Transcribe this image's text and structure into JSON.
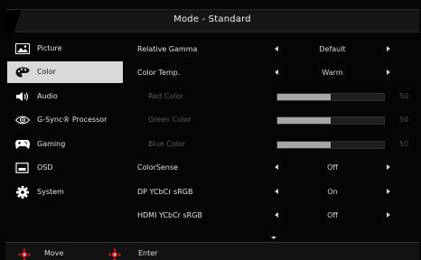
{
  "header": {
    "title": "Mode - Standard"
  },
  "sidebar": {
    "items": [
      {
        "label": "Picture",
        "icon": "picture-icon"
      },
      {
        "label": "Color",
        "icon": "palette-icon",
        "selected": true
      },
      {
        "label": "Audio",
        "icon": "speaker-icon"
      },
      {
        "label": "G-Sync® Processor",
        "icon": "gsync-eye-icon"
      },
      {
        "label": "Gaming",
        "icon": "gamepad-icon"
      },
      {
        "label": "OSD",
        "icon": "osd-screen-icon"
      },
      {
        "label": "System",
        "icon": "gear-icon"
      }
    ]
  },
  "settings": {
    "rows": [
      {
        "label": "Relative Gamma",
        "type": "select",
        "value": "Default"
      },
      {
        "label": "Color Temp.",
        "type": "select",
        "value": "Warm"
      },
      {
        "label": "Red Color",
        "type": "slider",
        "value": 50,
        "max": 100,
        "disabled": true
      },
      {
        "label": "Green Color",
        "type": "slider",
        "value": 50,
        "max": 100,
        "disabled": true
      },
      {
        "label": "Blue Color",
        "type": "slider",
        "value": 50,
        "max": 100,
        "disabled": true
      },
      {
        "label": "ColorSense",
        "type": "select",
        "value": "Off"
      },
      {
        "label": "DP YCbCr sRGB",
        "type": "select",
        "value": "On"
      },
      {
        "label": "HDMI YCbCr sRGB",
        "type": "select",
        "value": "Off"
      }
    ]
  },
  "footer": {
    "move_label": "Move",
    "enter_label": "Enter"
  },
  "colors": {
    "selected_bg": "#d9d9d9",
    "accent_red": "#e21b23",
    "slider_fill": "#a6a6a6"
  }
}
